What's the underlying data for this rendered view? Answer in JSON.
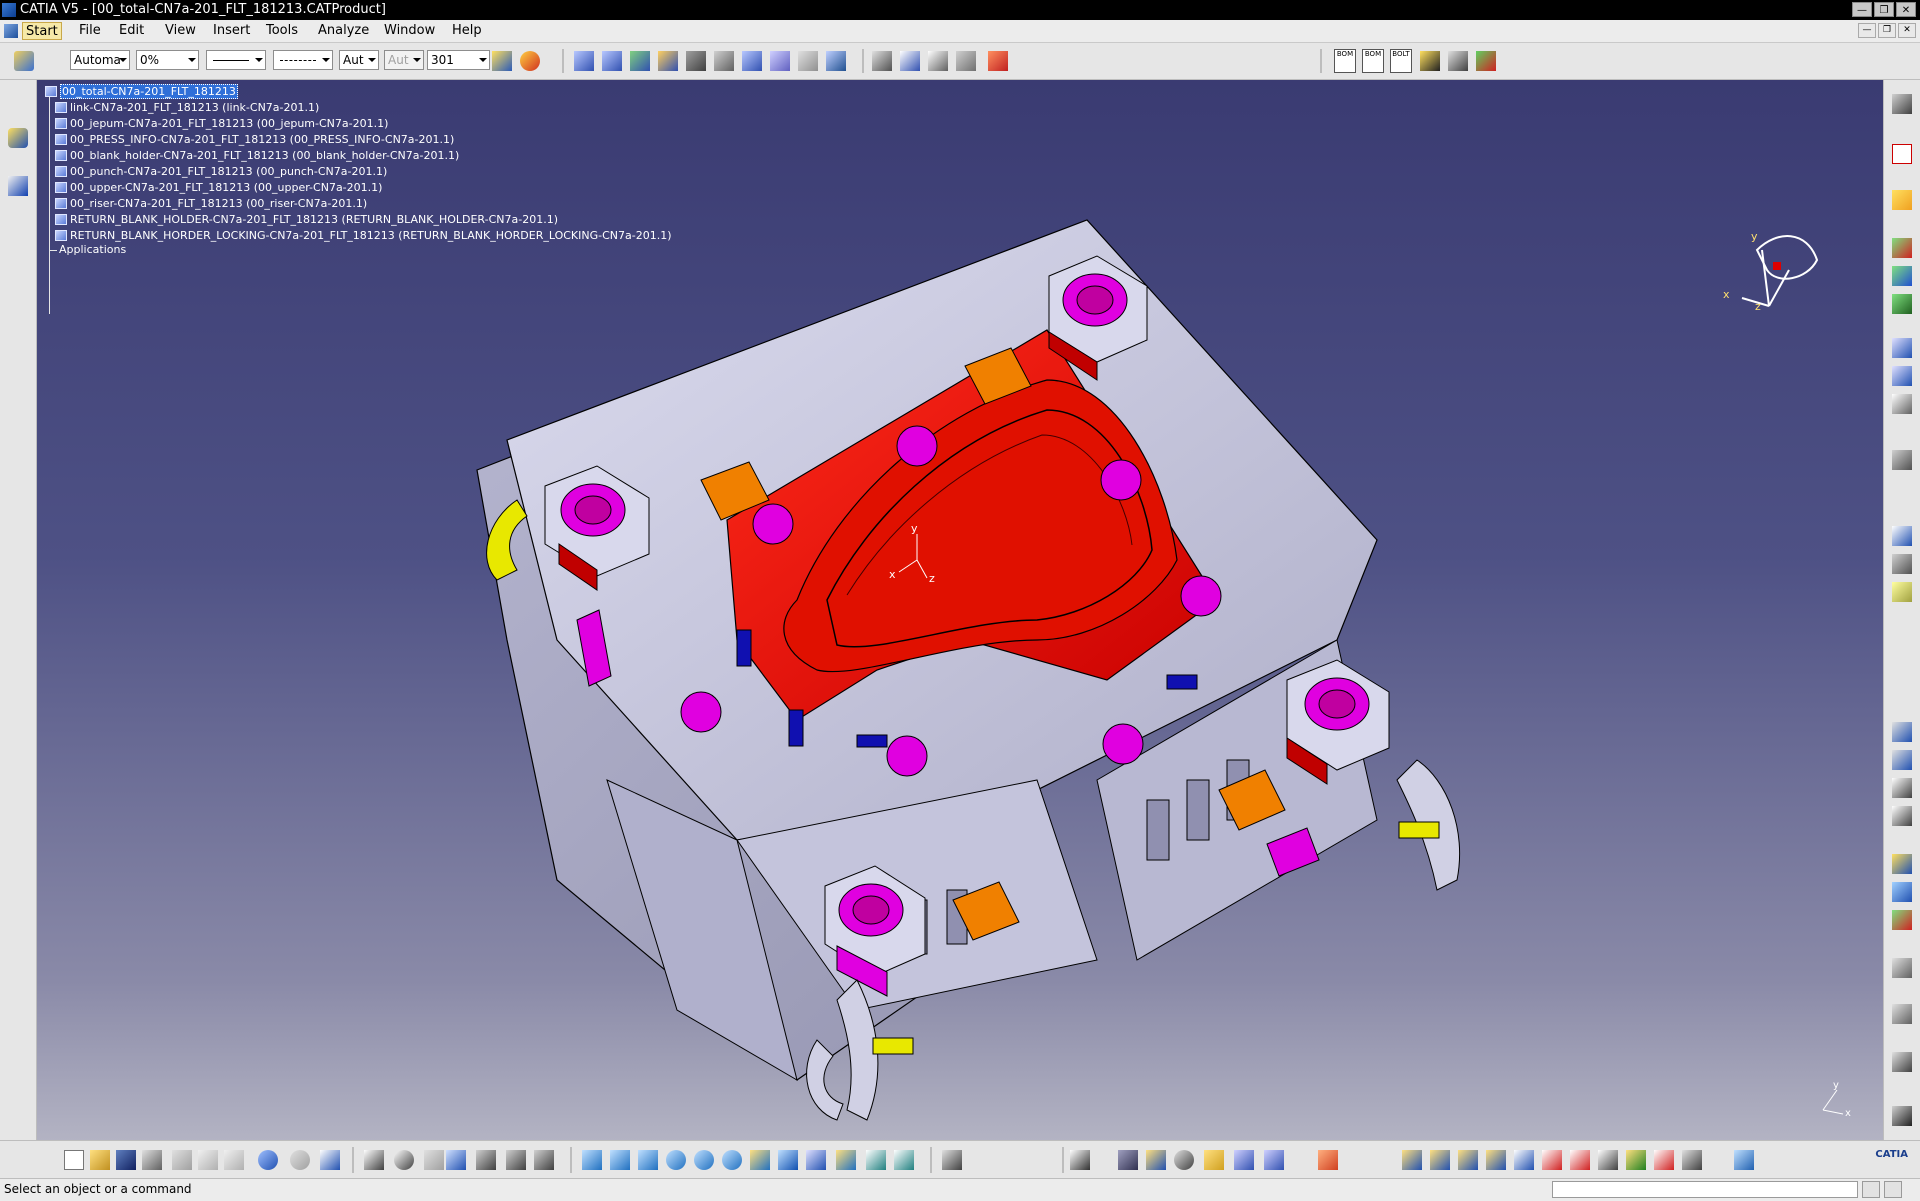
{
  "window": {
    "title": "CATIA V5 - [00_total-CN7a-201_FLT_181213.CATProduct]"
  },
  "menu": {
    "items": [
      "Start",
      "File",
      "Edit",
      "View",
      "Insert",
      "Tools",
      "Analyze",
      "Window",
      "Help"
    ]
  },
  "toolbar": {
    "combos": [
      {
        "name": "color-combo",
        "value": "Automa"
      },
      {
        "name": "transparency-combo",
        "value": "0%"
      },
      {
        "name": "line-thickness-combo",
        "value": ""
      },
      {
        "name": "linetype-combo",
        "value": ""
      },
      {
        "name": "point-symbol-combo",
        "value": "Aut"
      },
      {
        "name": "rendering-style-combo",
        "value": "Aut"
      },
      {
        "name": "layer-combo",
        "value": "301"
      }
    ],
    "right_icons": {
      "bom1": "BOM",
      "bom2": "BOM",
      "bom3": "BOLT"
    }
  },
  "tree": {
    "root": "00_total-CN7a-201_FLT_181213",
    "children": [
      "link-CN7a-201_FLT_181213 (link-CN7a-201.1)",
      "00_jepum-CN7a-201_FLT_181213 (00_jepum-CN7a-201.1)",
      "00_PRESS_INFO-CN7a-201_FLT_181213 (00_PRESS_INFO-CN7a-201.1)",
      "00_blank_holder-CN7a-201_FLT_181213 (00_blank_holder-CN7a-201.1)",
      "00_punch-CN7a-201_FLT_181213 (00_punch-CN7a-201.1)",
      "00_upper-CN7a-201_FLT_181213 (00_upper-CN7a-201.1)",
      "00_riser-CN7a-201_FLT_181213 (00_riser-CN7a-201.1)",
      "RETURN_BLANK_HOLDER-CN7a-201_FLT_181213 (RETURN_BLANK_HOLDER-CN7a-201.1)",
      "RETURN_BLANK_HORDER_LOCKING-CN7a-201_FLT_181213 (RETURN_BLANK_HORDER_LOCKING-CN7a-201.1)"
    ],
    "applications": "Applications"
  },
  "compass": {
    "x": "x",
    "y": "y",
    "z": "z"
  },
  "axis_small": {
    "y": "y",
    "x": "x"
  },
  "model_axis": {
    "y": "y",
    "x": "x",
    "z": "z"
  },
  "status": {
    "text": "Select an object or a command"
  },
  "logo": {
    "text": "CATIA"
  },
  "colors": {
    "viewport_top": "#3a3b72",
    "viewport_bottom": "#b3b3c3",
    "die_body": "#c8c8de",
    "punch_red": "#e00000",
    "pad_magenta": "#e000e0",
    "pad_orange": "#f08000",
    "pin_yellow": "#e8e800"
  }
}
